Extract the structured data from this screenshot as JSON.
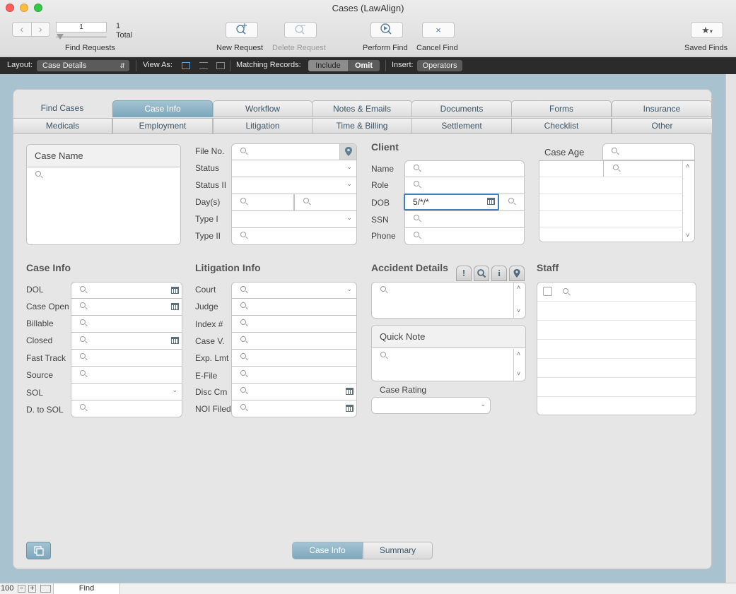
{
  "window": {
    "title": "Cases (LawAlign)"
  },
  "toolbar": {
    "record_value": "1",
    "record_count": "1",
    "total_label": "Total",
    "find_requests_label": "Find Requests",
    "new_request_label": "New Request",
    "delete_request_label": "Delete Request",
    "perform_find_label": "Perform Find",
    "cancel_find_label": "Cancel Find",
    "saved_finds_label": "Saved Finds"
  },
  "layoutbar": {
    "layout_label": "Layout:",
    "layout_value": "Case Details",
    "view_as_label": "View As:",
    "matching_label": "Matching Records:",
    "include_label": "Include",
    "omit_label": "Omit",
    "insert_label": "Insert:",
    "operators_label": "Operators"
  },
  "tabs_row1": [
    "Find Cases",
    "Case Info",
    "Workflow",
    "Notes & Emails",
    "Documents",
    "Forms",
    "Insurance"
  ],
  "tabs_row2": [
    "Medicals",
    "Employment",
    "Litigation",
    "Time & Billing",
    "Settlement",
    "Checklist",
    "Other"
  ],
  "case_name": {
    "title": "Case Name"
  },
  "file_fields": {
    "file_no": "File No.",
    "status": "Status",
    "status2": "Status II",
    "days": "Day(s)",
    "type1": "Type I",
    "type2": "Type II"
  },
  "client": {
    "title": "Client",
    "name": "Name",
    "role": "Role",
    "dob": "DOB",
    "dob_value": "5/*/*",
    "ssn": "SSN",
    "phone": "Phone"
  },
  "case_age": {
    "title": "Case Age"
  },
  "case_info": {
    "title": "Case Info",
    "labels": [
      "DOL",
      "Case Open",
      "Billable",
      "Closed",
      "Fast Track",
      "Source",
      "SOL",
      "D. to SOL"
    ]
  },
  "litigation_info": {
    "title": "Litigation Info",
    "labels": [
      "Court",
      "Judge",
      "Index #",
      "Case V.",
      "Exp. Lmt",
      "E-File",
      "Disc Cm",
      "NOI Filed"
    ]
  },
  "accident": {
    "title": "Accident Details",
    "icons": [
      "!",
      "Q",
      "i",
      "pin"
    ]
  },
  "quick_note": {
    "title": "Quick Note"
  },
  "case_rating": {
    "title": "Case Rating"
  },
  "staff": {
    "title": "Staff"
  },
  "bottom_tabs": [
    "Case Info",
    "Summary"
  ],
  "statusbar": {
    "zoom": "100",
    "mode": "Find"
  },
  "colors": {
    "accent": "#7ea7bc",
    "layoutbar_bg": "#2b2b2b",
    "content_bg": "#a8c3cf",
    "panel_bg": "#e6e6e6",
    "dob_highlight": "#3d7fbf"
  }
}
